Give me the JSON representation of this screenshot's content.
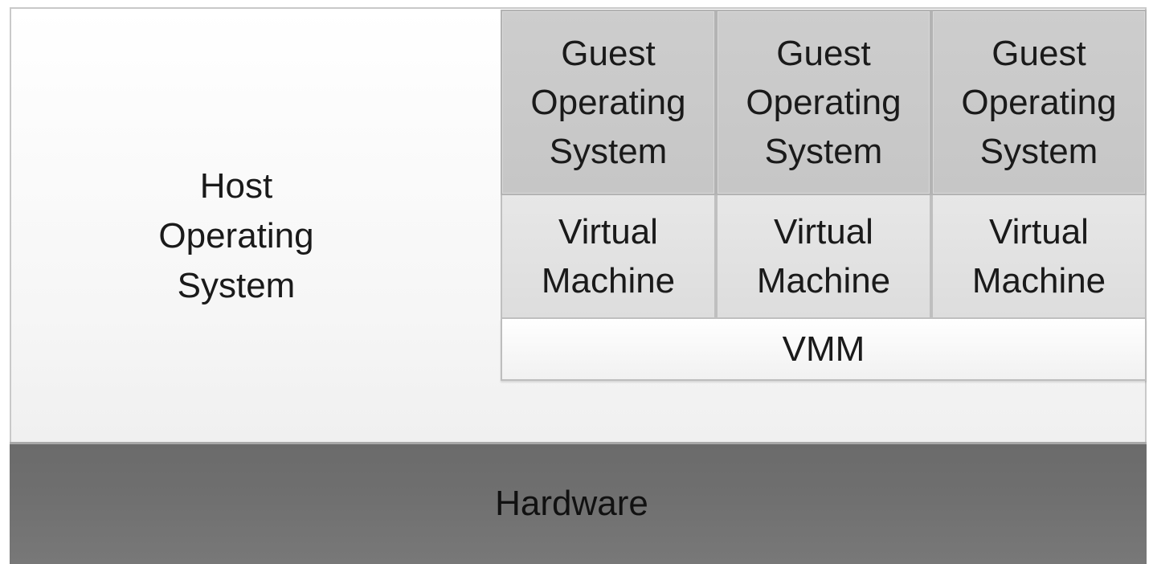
{
  "diagram": {
    "host_os_label": "Host\nOperating\nSystem",
    "guests": [
      {
        "os_label": "Guest\nOperating\nSystem",
        "vm_label": "Virtual\nMachine"
      },
      {
        "os_label": "Guest\nOperating\nSystem",
        "vm_label": "Virtual\nMachine"
      },
      {
        "os_label": "Guest\nOperating\nSystem",
        "vm_label": "Virtual\nMachine"
      }
    ],
    "vmm_label": "VMM",
    "hardware_label": "Hardware"
  }
}
